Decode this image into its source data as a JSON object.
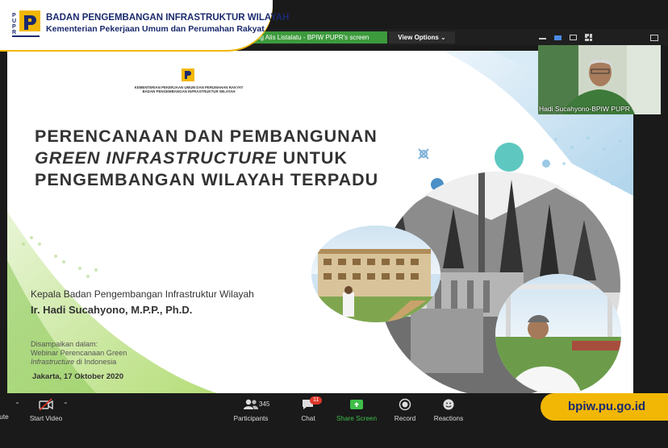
{
  "org": {
    "title": "BADAN PENGEMBANGAN INFRASTRUKTUR WILAYAH",
    "subtitle": "Kementerian Pekerjaan Umum dan Perumahan Rakyat",
    "logo_letters": "PUPR"
  },
  "zoom_bar": {
    "share_banner": "ng Alis Listalatu - BPIW PUPR's screen",
    "view_options": "View Options ⌄"
  },
  "slide": {
    "ministry_line1": "KEMENTERIAN PEKERJAAN UMUM DAN PERUMAHAN RAKYAT",
    "ministry_line2": "BADAN PENGEMBANGAN INFRASTRUKTUR WILAYAH",
    "title_line1": "PERENCANAAN DAN PEMBANGUNAN",
    "title_line2_italic": "GREEN INFRASTRUCTURE",
    "title_line2_rest": " UNTUK",
    "title_line3": "PENGEMBANGAN WILAYAH TERPADU",
    "speaker_role": "Kepala Badan Pengembangan Infrastruktur Wilayah",
    "speaker_name": "Ir. Hadi Sucahyono, M.P.P., Ph.D.",
    "delivered_label": "Disampaikan dalam:",
    "event_line1": "Webinar Perencanaan Green",
    "event_line2_italic": "Infrastructure",
    "event_line2_rest": " di Indonesia",
    "event_date": "Jakarta, 17 Oktober 2020"
  },
  "self_video": {
    "label": "Hadi Sucahyono-BPIW PUPR"
  },
  "toolbar": {
    "mute_label": "ute",
    "start_video_label": "Start Video",
    "participants_label": "Participants",
    "participants_count": "345",
    "chat_label": "Chat",
    "chat_badge": "11",
    "share_screen_label": "Share Screen",
    "record_label": "Record",
    "reactions_label": "Reactions"
  },
  "footer": {
    "url": "bpiw.pu.go.id"
  },
  "colors": {
    "brand_navy": "#1b2a6e",
    "brand_yellow": "#f2b705",
    "zoom_green": "#3c9a3c",
    "share_green": "#3fbf4a",
    "chat_badge": "#e0372b"
  }
}
